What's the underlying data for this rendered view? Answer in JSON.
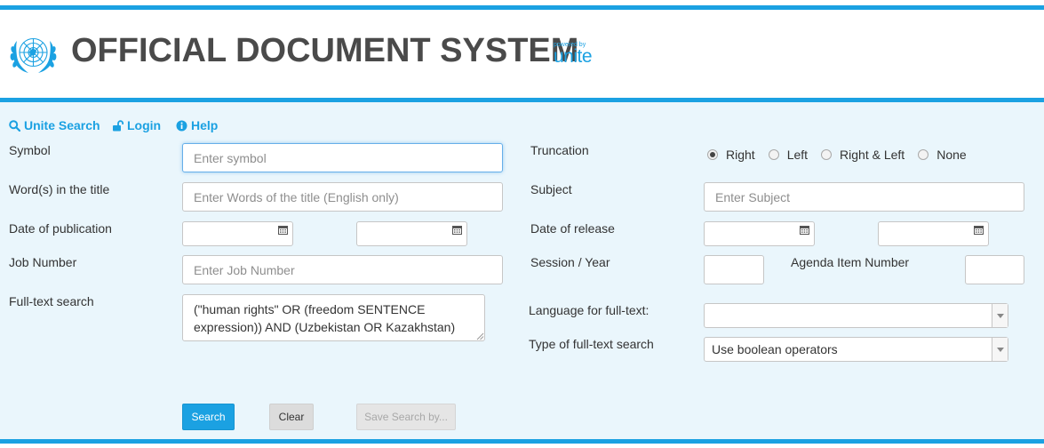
{
  "header": {
    "title": "OFFICIAL DOCUMENT SYSTEM",
    "powered_by": "powered by",
    "brand": "unite"
  },
  "nav": {
    "search": "Unite Search",
    "login": "Login",
    "help": "Help"
  },
  "form": {
    "symbol": {
      "label": "Symbol",
      "placeholder": "Enter symbol"
    },
    "title_words": {
      "label": "Word(s) in the title",
      "placeholder": "Enter Words of the title (English only)"
    },
    "pub_date": {
      "label": "Date of publication"
    },
    "job_number": {
      "label": "Job Number",
      "placeholder": "Enter Job Number"
    },
    "fulltext": {
      "label": "Full-text search",
      "value": "(\"human rights\" OR (freedom SENTENCE expression)) AND (Uzbekistan OR Kazakhstan)"
    },
    "truncation": {
      "label": "Truncation",
      "options": [
        "Right",
        "Left",
        "Right & Left",
        "None"
      ],
      "selected": "Right"
    },
    "subject": {
      "label": "Subject",
      "placeholder": "Enter Subject"
    },
    "release_date": {
      "label": "Date of release"
    },
    "session_year": {
      "label": "Session / Year"
    },
    "agenda_item": {
      "label": "Agenda Item Number"
    },
    "language": {
      "label": "Language for full-text:",
      "value": ""
    },
    "fulltext_type": {
      "label": "Type of full-text search",
      "value": "Use boolean operators"
    }
  },
  "buttons": {
    "search": "Search",
    "clear": "Clear",
    "save": "Save Search by..."
  },
  "colors": {
    "accent": "#1ba1e2",
    "panel_bg": "#eaf6fc",
    "title_text": "#4a4a4a"
  },
  "icons": {
    "logo": "un-emblem-icon",
    "search": "search-icon",
    "login": "unlock-icon",
    "help": "info-icon",
    "calendar": "calendar-icon",
    "dropdown": "chevron-down-icon"
  }
}
